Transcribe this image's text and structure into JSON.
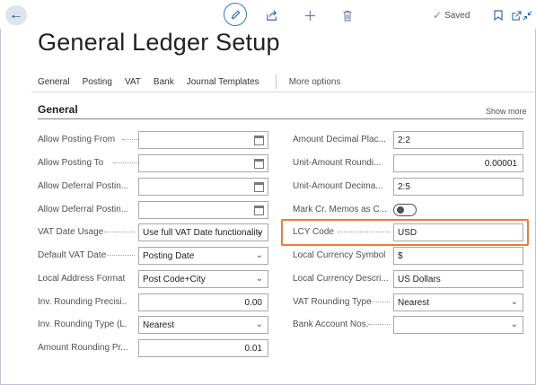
{
  "topbar": {
    "back_icon": "arrow-left-icon",
    "saved_label": "Saved"
  },
  "page_title": "General Ledger Setup",
  "nav": {
    "items": [
      "General",
      "Posting",
      "VAT",
      "Bank",
      "Journal Templates"
    ],
    "more": "More options"
  },
  "section": {
    "title": "General",
    "show_more": "Show more"
  },
  "left_fields": [
    {
      "label": "Allow Posting From",
      "value": "",
      "control": "date"
    },
    {
      "label": "Allow Posting To",
      "value": "",
      "control": "date"
    },
    {
      "label": "Allow Deferral Postin...",
      "value": "",
      "control": "date"
    },
    {
      "label": "Allow Deferral Postin...",
      "value": "",
      "control": "date"
    },
    {
      "label": "VAT Date Usage",
      "value": "Use full VAT Date functionality",
      "control": "select"
    },
    {
      "label": "Default VAT Date",
      "value": "Posting Date",
      "control": "select"
    },
    {
      "label": "Local Address Format",
      "value": "Post Code+City",
      "control": "select"
    },
    {
      "label": "Inv. Rounding Precisi...",
      "value": "0.00",
      "control": "number"
    },
    {
      "label": "Inv. Rounding Type (L...",
      "value": "Nearest",
      "control": "select"
    },
    {
      "label": "Amount Rounding Pr...",
      "value": "0.01",
      "control": "number"
    }
  ],
  "right_fields": [
    {
      "label": "Amount Decimal Plac...",
      "value": "2:2",
      "control": "text"
    },
    {
      "label": "Unit-Amount Roundi...",
      "value": "0.00001",
      "control": "number"
    },
    {
      "label": "Unit-Amount Decima...",
      "value": "2:5",
      "control": "text"
    },
    {
      "label": "Mark Cr. Memos as C...",
      "value": "",
      "control": "toggle",
      "toggle_on": false
    },
    {
      "label": "LCY Code",
      "value": "USD",
      "control": "text"
    },
    {
      "label": "Local Currency Symbol",
      "value": "$",
      "control": "text"
    },
    {
      "label": "Local Currency Descri...",
      "value": "US Dollars",
      "control": "text"
    },
    {
      "label": "VAT Rounding Type",
      "value": "Nearest",
      "control": "select"
    },
    {
      "label": "Bank Account Nos.",
      "value": "",
      "control": "select"
    }
  ],
  "colors": {
    "accent": "#2f6eb0",
    "highlight": "#ed7d31"
  }
}
